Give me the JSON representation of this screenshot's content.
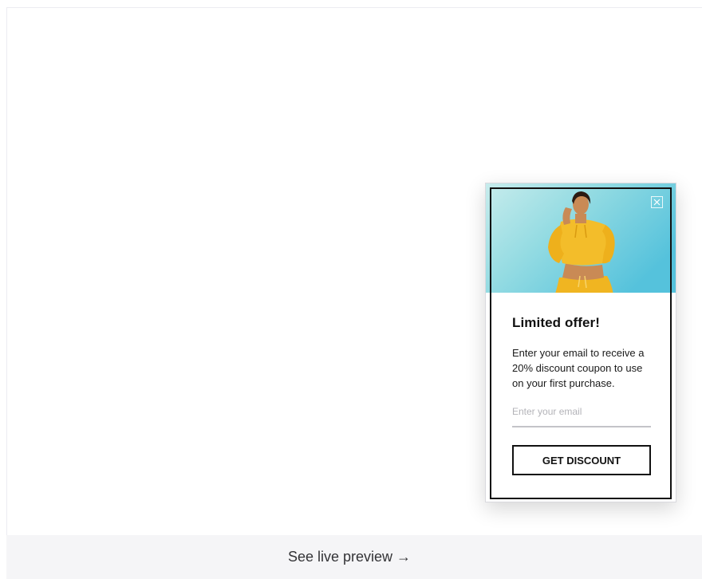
{
  "popup": {
    "close_icon": "close-icon",
    "hero_image": "woman-yellow-hoodie-photo",
    "title": "Limited offer!",
    "description": "Enter your email to receive a 20% discount coupon to use on your first purchase.",
    "email_placeholder": "Enter your email",
    "cta_label": "GET DISCOUNT"
  },
  "footer": {
    "link_label": "See live preview →"
  },
  "colors": {
    "page_bg": "#ffffff",
    "footer_bg": "#f5f5f7",
    "hero_sky": "#5ec8dd",
    "hoodie": "#f2b824",
    "border": "#111111"
  }
}
